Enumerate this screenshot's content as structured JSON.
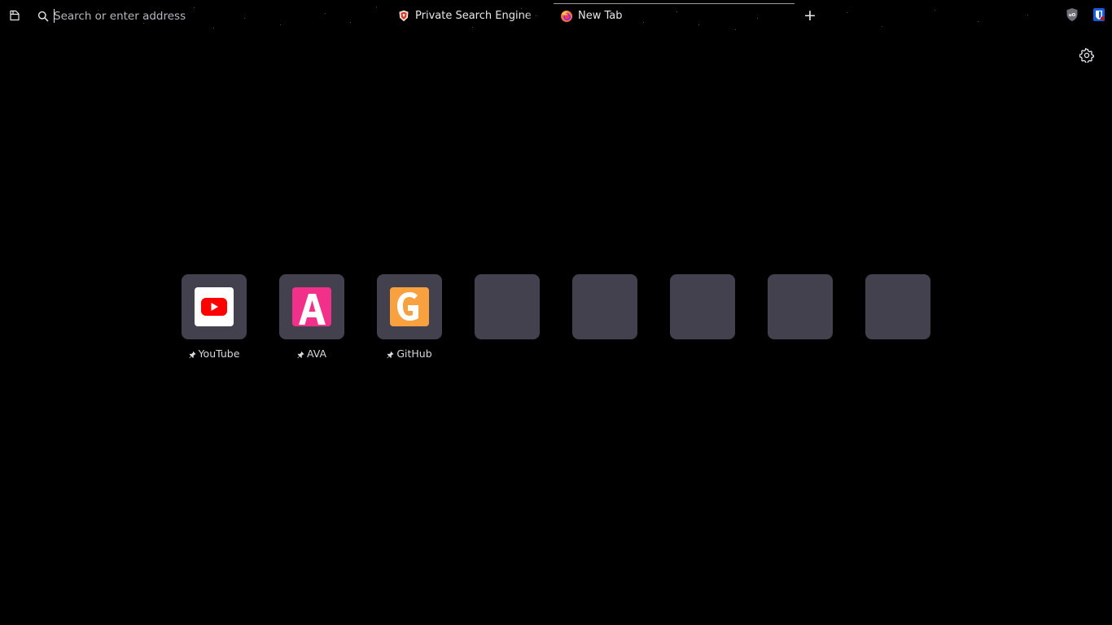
{
  "toolbar": {
    "search_placeholder": "Search or enter address",
    "new_tab_label": "+",
    "extensions": [
      "ublock-origin-icon",
      "bitwarden-icon"
    ]
  },
  "tabs": [
    {
      "title": "Private Search Engine - Brave Search",
      "favicon": "brave-icon",
      "active": false
    },
    {
      "title": "New Tab",
      "favicon": "firefox-icon",
      "active": true
    }
  ],
  "shortcuts": [
    {
      "label": "YouTube",
      "pinned": true,
      "logo": "youtube-icon",
      "color": "#ff0000"
    },
    {
      "label": "AVA",
      "pinned": true,
      "logo": "ava-icon",
      "color": "#f1308a"
    },
    {
      "label": "GitHub",
      "pinned": true,
      "logo": "github-icon",
      "color": "#f9a03f"
    },
    {
      "label": "",
      "pinned": false
    },
    {
      "label": "",
      "pinned": false
    },
    {
      "label": "",
      "pinned": false
    },
    {
      "label": "",
      "pinned": false
    },
    {
      "label": "",
      "pinned": false
    }
  ],
  "colors": {
    "background": "#000000",
    "tile": "#42414d",
    "text": "#e8e8ec"
  }
}
